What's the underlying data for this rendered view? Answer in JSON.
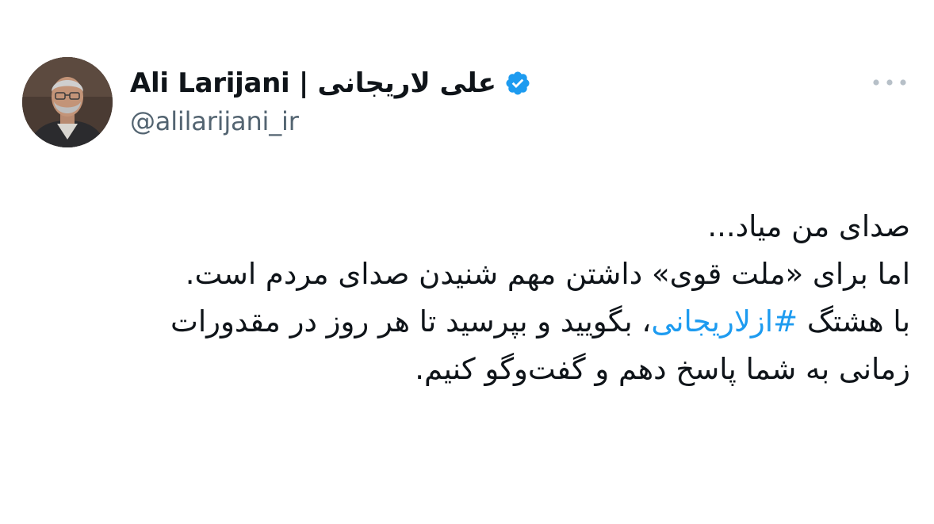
{
  "author": {
    "display_name": "Ali Larijani | علی لاریجانی",
    "handle": "@alilarijani_ir",
    "verified": true,
    "avatar": "profile-photo-icon"
  },
  "actions": {
    "more_icon": "more-horizontal-icon"
  },
  "tweet": {
    "line1": "صدای من میاد...",
    "line2": "اما برای «ملت قوی» داشتن مهم شنیدن صدای مردم است.",
    "line3_before": "با هشتگ ",
    "hashtag": "#ازلاریجانی",
    "line3_after": "، بگویید و بپرسید تا هر روز در مقدورات",
    "line4": "زمانی به شما پاسخ دهم و گفت‌وگو کنیم."
  },
  "colors": {
    "text": "#0f1419",
    "secondary": "#536471",
    "accent": "#1d9bf0"
  }
}
